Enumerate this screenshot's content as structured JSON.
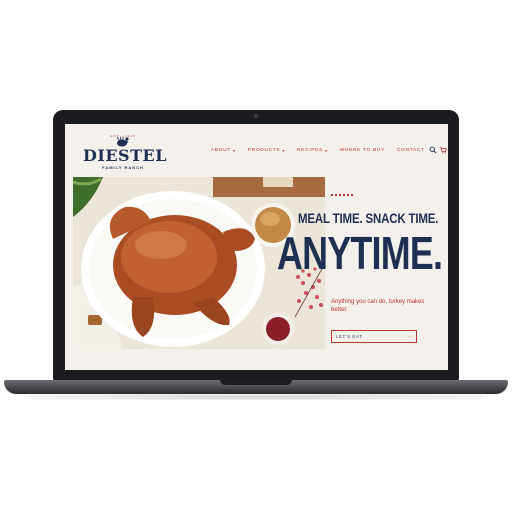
{
  "site": {
    "logo": {
      "est": "EST · 1949",
      "name": "DIESTEL",
      "sub": "FAMILY RANCH"
    },
    "nav": [
      {
        "label": "ABOUT",
        "has_menu": true
      },
      {
        "label": "PRODUCTS",
        "has_menu": true
      },
      {
        "label": "RECIPES",
        "has_menu": true
      },
      {
        "label": "WHERE TO BUY",
        "has_menu": false
      },
      {
        "label": "CONTACT",
        "has_menu": false
      }
    ],
    "caret": "▾",
    "icons": {
      "search": "search-icon",
      "cart": "cart-icon"
    }
  },
  "hero": {
    "headline_top": "MEAL TIME. SNACK TIME.",
    "headline_main": "ANYTIME.",
    "subtext": "Anything you can do, turkey makes better.",
    "cta_label": "LET'S EAT",
    "cta_arrow": "→"
  },
  "colors": {
    "navy": "#1f2f52",
    "red": "#b9362f",
    "background": "#f4f1ec"
  }
}
